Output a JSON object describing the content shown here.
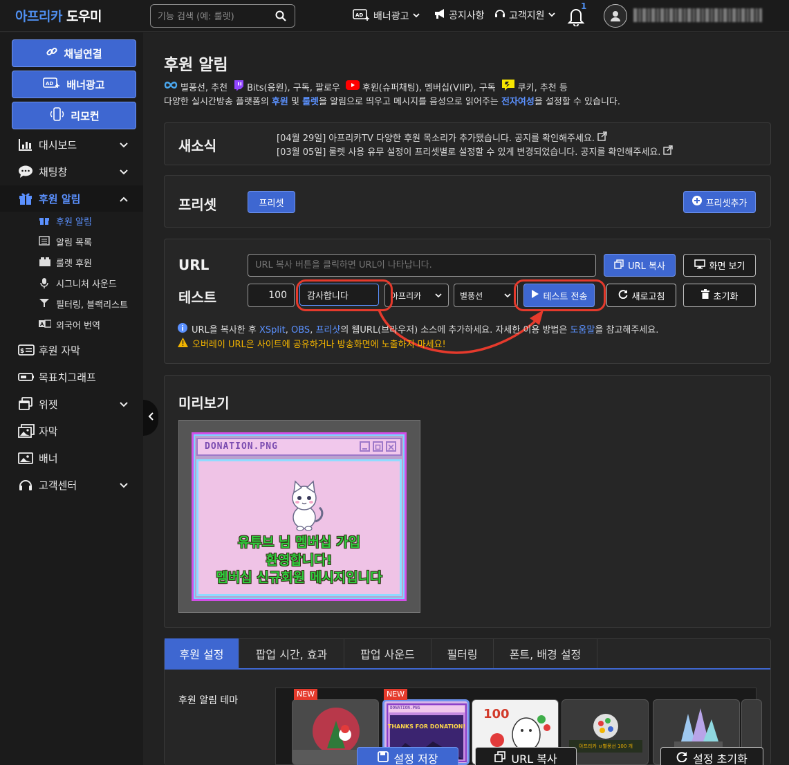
{
  "header": {
    "logo_part1": "아프리카",
    "logo_part2": "도우미",
    "search_placeholder": "기능 검색 (예: 룰렛)",
    "nav": {
      "banner_ad": "배너광고",
      "notice": "공지사항",
      "support": "고객지원",
      "notification_count": "1"
    }
  },
  "sidebar": {
    "buttons": {
      "channel_link": "채널연결",
      "banner_ad": "배너광고",
      "remote": "리모컨"
    },
    "menu": [
      {
        "label": "대시보드"
      },
      {
        "label": "채팅창"
      },
      {
        "label": "후원 알림"
      },
      {
        "label": "후원 자막"
      },
      {
        "label": "목표치그래프"
      },
      {
        "label": "위젯"
      },
      {
        "label": "자막"
      },
      {
        "label": "배너"
      },
      {
        "label": "고객센터"
      }
    ],
    "submenu": [
      {
        "label": "후원 알림"
      },
      {
        "label": "알림 목록"
      },
      {
        "label": "룰렛 후원"
      },
      {
        "label": "시그니처 사운드"
      },
      {
        "label": "필터링, 블랙리스트"
      },
      {
        "label": "외국어 번역"
      }
    ]
  },
  "page": {
    "title": "후원 알림",
    "desc_line1": {
      "p1": "별풍선, 추천",
      "p2": "Bits(응원), 구독, 팔로우",
      "p3": "후원(슈퍼채팅), 멤버십(VIIP), 구독",
      "p4": "쿠키, 추천 등"
    },
    "desc_line2": {
      "t1": "다양한 실시간방송 플랫폼의 ",
      "b1": "후원",
      "t2": " 및 ",
      "b2": "룰렛",
      "t3": "을 알림으로 띄우고 메시지를 음성으로 읽어주는 ",
      "b3": "전자여성",
      "t4": "을 설정할 수 있습니다."
    }
  },
  "news": {
    "title": "새소식",
    "items": [
      {
        "date": "[04월 29일]",
        "text": "아프리카TV 다양한 후원 목소리가 추가됐습니다. 공지를 확인해주세요."
      },
      {
        "date": "[03월 05일]",
        "text": "룰렛 사용 유무 설정이 프리셋별로 설정할 수 있게 변경되었습니다. 공지를 확인해주세요."
      }
    ]
  },
  "preset": {
    "title": "프리셋",
    "chip": "프리셋",
    "add_button": "프리셋추가"
  },
  "url_section": {
    "url_label": "URL",
    "url_placeholder": "URL 복사 버튼을 클릭하면 URL이 나타납니다.",
    "copy_button": "URL 복사",
    "view_button": "화면 보기",
    "test_label": "테스트",
    "amount_value": "100",
    "message_value": "감사합니다",
    "platform_value": "아프리카",
    "type_value": "별풍선",
    "send_button": "테스트 전송",
    "refresh_button": "새로고침",
    "reset_button": "초기화",
    "info": {
      "t1": "URL을 복사한 후 ",
      "l1": "XSplit",
      "t2": ", ",
      "l2": "OBS",
      "t3": ", ",
      "l3": "프리샷",
      "t4": "의 웹URL(브라우저) 소스에 추가하세요. 자세한 이용 방법은 ",
      "l4": "도움말",
      "t5": "을 참고해주세요."
    },
    "warning": "오버레이 URL은 사이트에 공유하거나 방송화면에 노출하지 마세요!"
  },
  "preview": {
    "title": "미리보기",
    "window_title": "DONATION.PNG",
    "line1": "유튜브 님 멤버십 가입",
    "line2": "환영합니다!",
    "line3": "멤버십 신규회원 메시지입니다"
  },
  "tabs": [
    {
      "label": "후원 설정"
    },
    {
      "label": "팝업 시간, 효과"
    },
    {
      "label": "팝업 사운드"
    },
    {
      "label": "필터링"
    },
    {
      "label": "폰트, 배경 설정"
    }
  ],
  "theme": {
    "label": "후원 알림 테마",
    "new_tag": "NEW",
    "thumb2_title": "DONATION.PNG",
    "thumb2_text": "THANKS FOR DONATION!",
    "thumb3_number": "100",
    "thumb4_text": "아프리카 ㅂ별풍선 100 개"
  },
  "footer": {
    "save": "설정 저장",
    "url_copy": "URL 복사",
    "reset": "설정 초기화"
  },
  "colors": {
    "accent": "#3e67d1",
    "link": "#5b91ff",
    "highlight": "#e53a2c",
    "warning": "#f2b400"
  }
}
